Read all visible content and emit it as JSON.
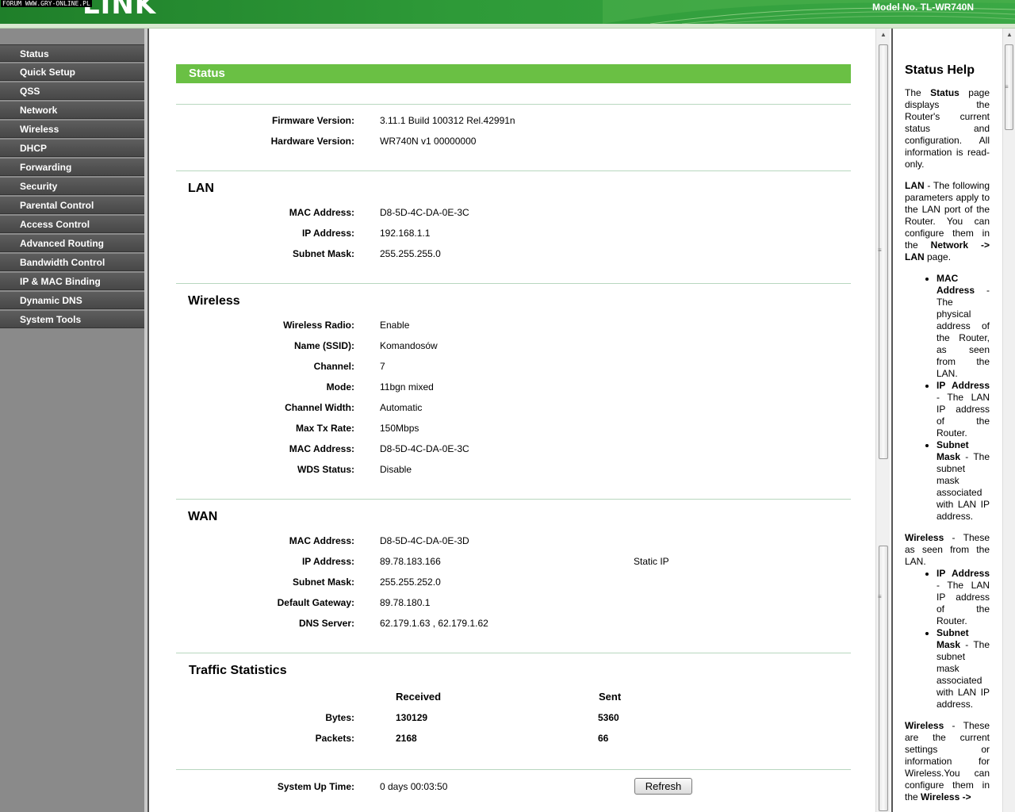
{
  "header": {
    "forum_watermark": "FORUM WWW.GRY-ONLINE.PL",
    "logo_text": "LINK",
    "model": "Model No. TL-WR740N"
  },
  "menu": {
    "items": [
      "Status",
      "Quick Setup",
      "QSS",
      "Network",
      "Wireless",
      "DHCP",
      "Forwarding",
      "Security",
      "Parental Control",
      "Access Control",
      "Advanced Routing",
      "Bandwidth Control",
      "IP & MAC Binding",
      "Dynamic DNS",
      "System Tools"
    ]
  },
  "status": {
    "title": "Status",
    "firmware_label": "Firmware Version:",
    "firmware_value": "3.11.1 Build 100312 Rel.42991n",
    "hardware_label": "Hardware Version:",
    "hardware_value": "WR740N v1 00000000",
    "lan": {
      "title": "LAN",
      "mac_label": "MAC Address:",
      "mac_value": "D8-5D-4C-DA-0E-3C",
      "ip_label": "IP Address:",
      "ip_value": "192.168.1.1",
      "mask_label": "Subnet Mask:",
      "mask_value": "255.255.255.0"
    },
    "wireless": {
      "title": "Wireless",
      "radio_label": "Wireless Radio:",
      "radio_value": "Enable",
      "ssid_label": "Name (SSID):",
      "ssid_value": "Komandosów",
      "channel_label": "Channel:",
      "channel_value": "7",
      "mode_label": "Mode:",
      "mode_value": "11bgn mixed",
      "width_label": "Channel Width:",
      "width_value": "Automatic",
      "rate_label": "Max Tx Rate:",
      "rate_value": "150Mbps",
      "mac_label": "MAC Address:",
      "mac_value": "D8-5D-4C-DA-0E-3C",
      "wds_label": "WDS Status:",
      "wds_value": "Disable"
    },
    "wan": {
      "title": "WAN",
      "mac_label": "MAC Address:",
      "mac_value": "D8-5D-4C-DA-0E-3D",
      "ip_label": "IP Address:",
      "ip_value": "89.78.183.166",
      "ip_type": "Static IP",
      "mask_label": "Subnet Mask:",
      "mask_value": "255.255.252.0",
      "gw_label": "Default Gateway:",
      "gw_value": "89.78.180.1",
      "dns_label": "DNS Server:",
      "dns_value": "62.179.1.63 , 62.179.1.62"
    },
    "traffic": {
      "title": "Traffic Statistics",
      "received_header": "Received",
      "sent_header": "Sent",
      "bytes_label": "Bytes:",
      "bytes_received": "130129",
      "bytes_sent": "5360",
      "packets_label": "Packets:",
      "packets_received": "2168",
      "packets_sent": "66"
    },
    "uptime_label": "System Up Time:",
    "uptime_value": "0 days 00:03:50",
    "refresh_label": "Refresh"
  },
  "help": {
    "title": "Status Help",
    "p1_a": "The ",
    "p1_b": "Status",
    "p1_c": " page displays the Router's current status and configuration. All information is read-only.",
    "lan_a": "LAN",
    "lan_b": " - The following parameters apply to the LAN port of the Router. You can configure them in the ",
    "lan_c": "Network -> LAN",
    "lan_d": " page.",
    "b1_a": "MAC Address",
    "b1_b": " - The physical address of the Router, as seen from the LAN.",
    "b2_a": "IP Address",
    "b2_b": " - The LAN IP address of the Router.",
    "b3_a": "Subnet Mask",
    "b3_b": " - The subnet mask associated with LAN IP address.",
    "wl_a": "Wireless",
    "wl_b": " - These as seen from the LAN.",
    "b4_a": "IP Address",
    "b4_b": " - The LAN IP address of the Router.",
    "b5_a": "Subnet Mask",
    "b5_b": " - The subnet mask associated with LAN IP address.",
    "wl2_a": "Wireless",
    "wl2_b": " - These are the current settings or information for Wireless.You can configure them in the ",
    "wl2_c": "Wireless ->"
  },
  "colors": {
    "header_green": "#2e9a38",
    "title_bar_green": "#6ac044",
    "menu_item": "#4d4d4d",
    "menu_bg": "#8a8a8a"
  }
}
